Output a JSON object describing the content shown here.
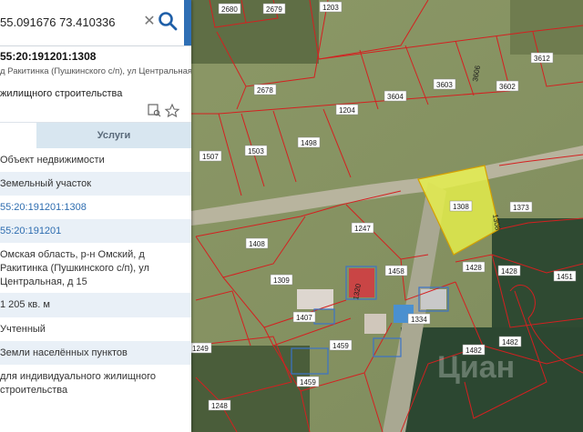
{
  "search": {
    "value": "55.091676 73.410336"
  },
  "parcel": {
    "cadastral_title": "55:20:191201:1308",
    "address_short": "д Ракитинка (Пушкинского с/п), ул Центральная, д",
    "purpose": "жилищного строительства"
  },
  "tabs": {
    "services": "Услуги"
  },
  "rows": [
    "Объект недвижимости",
    "Земельный участок",
    "55:20:191201:1308",
    "55:20:191201",
    "Омская область, р-н Омский, д Ракитинка (Пушкинского с/п), ул Центральная, д 15",
    "1 205 кв. м",
    "Учтенный",
    "Земли населённых пунктов",
    "для индивидуального жилищного строительства"
  ],
  "map": {
    "labels": {
      "l2680": "2680",
      "l2679": "2679",
      "l1203": "1203",
      "l3612": "3612",
      "l2678": "2678",
      "l3604": "3604",
      "l3603": "3603",
      "l3602": "3602",
      "l3606": "3606",
      "l1204": "1204",
      "l1503": "1503",
      "l1498": "1498",
      "l1507": "1507",
      "l1308": "1308",
      "l1308v": "1308",
      "l1373": "1373",
      "l1247": "1247",
      "l1408": "1408",
      "l1309": "1309",
      "l1458": "1458",
      "l1428a": "1428",
      "l1428b": "1428",
      "l1451": "1451",
      "l1407": "1407",
      "l1459a": "1459",
      "l1334": "1334",
      "l1482a": "1482",
      "l1482b": "1482",
      "l1249": "1249",
      "l1459b": "1459",
      "l1248": "1248",
      "l1320": "1320"
    },
    "highlight_color": "#e7f04a",
    "watermark": "Циан"
  }
}
